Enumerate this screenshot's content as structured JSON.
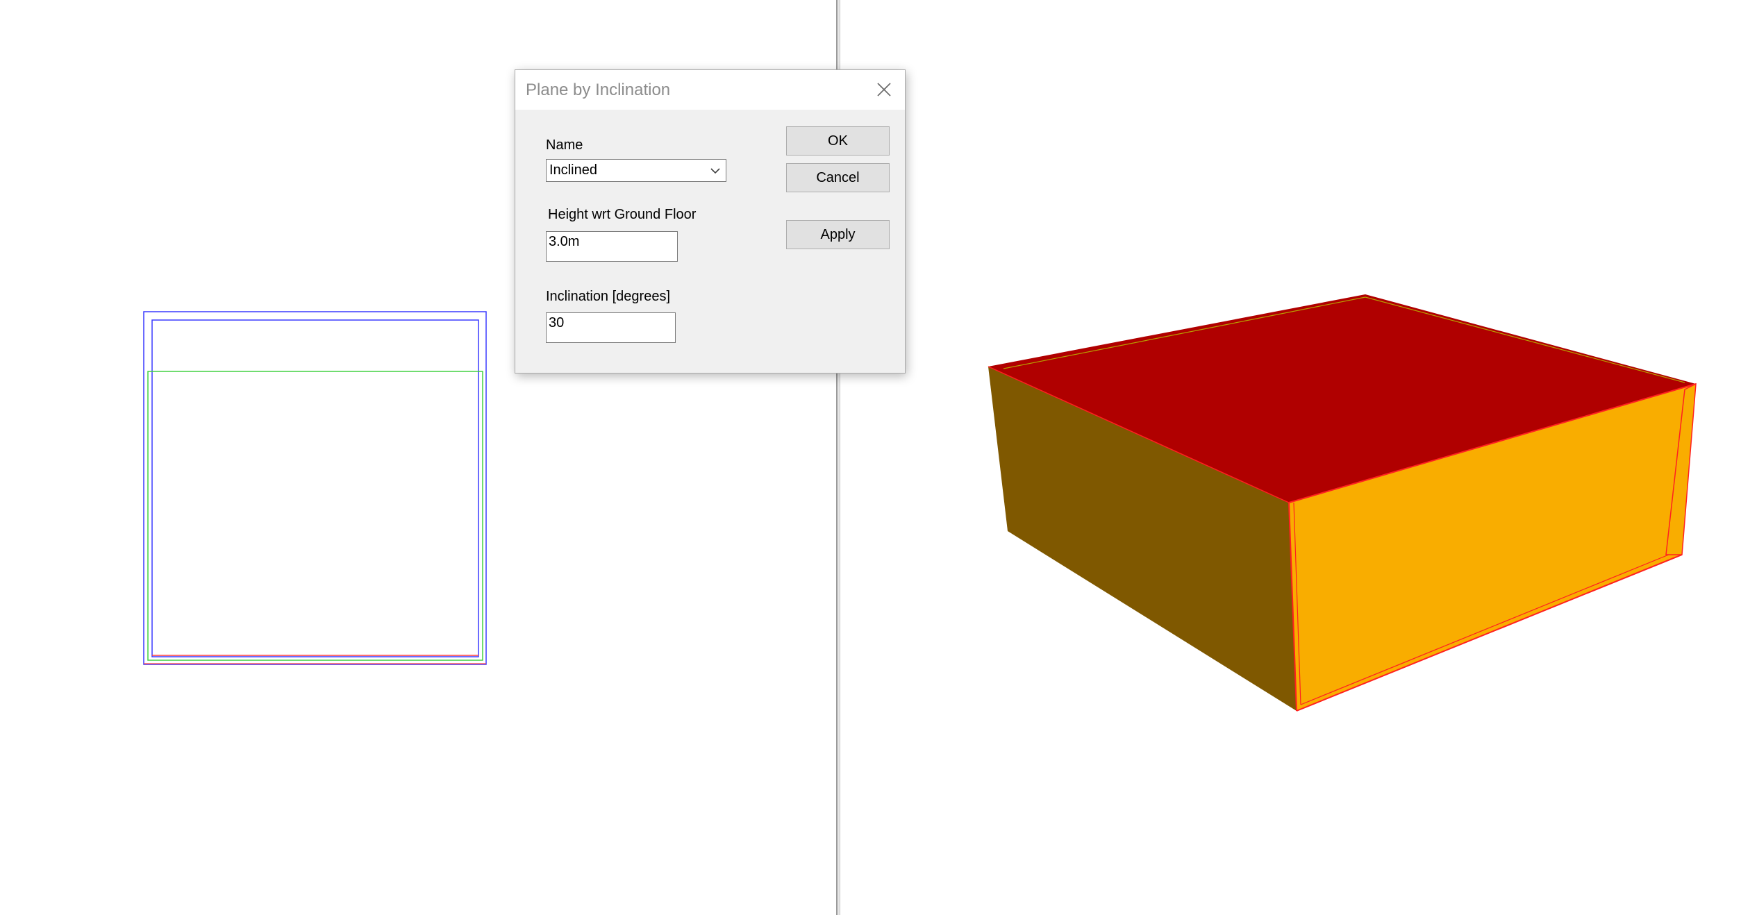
{
  "dialog": {
    "title": "Plane by Inclination",
    "close_icon": "close-icon",
    "name_label": "Name",
    "name_value": "Inclined",
    "height_label": "Height wrt Ground Floor",
    "height_value": "3.0m",
    "inclination_label": "Inclination [degrees]",
    "inclination_value": "30",
    "ok_label": "OK",
    "cancel_label": "Cancel",
    "apply_label": "Apply"
  },
  "colors": {
    "roof": "#b00000",
    "wall_left": "#7f5800",
    "wall_front": "#f9ad00",
    "edge_highlight": "#ff2020",
    "plan_outline_blue": "#3a3aff",
    "plan_outline_green": "#40d040",
    "plan_outline_red": "#ff4040",
    "dialog_background": "#f0f0f0"
  }
}
